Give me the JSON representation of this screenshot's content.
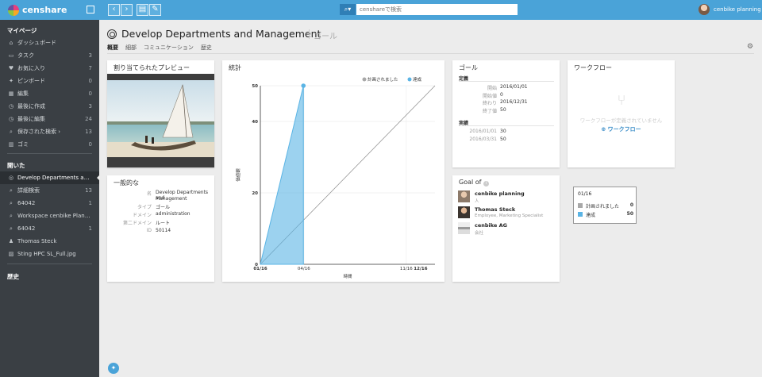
{
  "app": {
    "logo_text": "censhare"
  },
  "header_bar": {
    "search_placeholder": "censhareで検索",
    "user_name": "cenbike planning"
  },
  "sidebar": {
    "mypage_heading": "マイページ",
    "mypage_items": [
      {
        "icon": "home-icon",
        "glyph": "⌂",
        "label": "ダッシュボード",
        "count": ""
      },
      {
        "icon": "inbox-icon",
        "glyph": "▭",
        "label": "タスク",
        "count": "3"
      },
      {
        "icon": "heart-icon",
        "glyph": "♥",
        "label": "お気に入り",
        "count": "7"
      },
      {
        "icon": "pin-icon",
        "glyph": "✦",
        "label": "ピンボード",
        "count": "0"
      },
      {
        "icon": "edit-icon",
        "glyph": "▦",
        "label": "編集",
        "count": "0"
      },
      {
        "icon": "clock-icon",
        "glyph": "◷",
        "label": "最後に作成",
        "count": "3"
      },
      {
        "icon": "clock-icon",
        "glyph": "◷",
        "label": "最後に編集",
        "count": "24"
      },
      {
        "icon": "search-icon",
        "glyph": "⌕",
        "label": "保存された検索  ›",
        "count": "13"
      },
      {
        "icon": "trash-icon",
        "glyph": "▥",
        "label": "ゴミ",
        "count": "0"
      }
    ],
    "opened_heading": "開いた",
    "opened_items": [
      {
        "icon": "target-icon",
        "glyph": "◎",
        "label": "Develop Departments and Ma...",
        "count": ""
      },
      {
        "icon": "search-icon",
        "glyph": "⌕",
        "label": "詳細検索",
        "count": "13"
      },
      {
        "icon": "search-icon",
        "glyph": "⌕",
        "label": "64042",
        "count": "1"
      },
      {
        "icon": "search-icon",
        "glyph": "⌕",
        "label": "Workspace cenbike Planning",
        "count": ""
      },
      {
        "icon": "search-icon",
        "glyph": "⌕",
        "label": "64042",
        "count": "1"
      },
      {
        "icon": "user-icon",
        "glyph": "♟",
        "label": "Thomas Steck",
        "count": ""
      },
      {
        "icon": "image-icon",
        "glyph": "▨",
        "label": "Sting HPC SL_Full.jpg",
        "count": ""
      }
    ],
    "history_heading": "歴史"
  },
  "page": {
    "title": "Develop Departments and Management",
    "type_label": "ゴール",
    "tabs": [
      "概要",
      "細部",
      "コミュニケーション",
      "歴史"
    ]
  },
  "preview_card": {
    "title": "割り当てられたプレビュー"
  },
  "general_card": {
    "title": "一般的な",
    "rows": [
      {
        "key": "名",
        "value": "Develop Departments and"
      },
      {
        "key": "",
        "value": "Management"
      },
      {
        "key": "タイプ",
        "value": "ゴール"
      },
      {
        "key": "ドメイン",
        "value": "administration"
      },
      {
        "key": "第二ドメイン",
        "value": "ルート"
      },
      {
        "key": "ID",
        "value": "50114"
      }
    ]
  },
  "stats_card": {
    "title": "統計"
  },
  "goal_card": {
    "title": "ゴール",
    "definition_heading": "定義",
    "definition_rows": [
      {
        "key": "開始",
        "value": "2016/01/01"
      },
      {
        "key": "開始値",
        "value": "0"
      },
      {
        "key": "終わり",
        "value": "2016/12/31"
      },
      {
        "key": "終了値",
        "value": "50"
      }
    ],
    "actual_heading": "実績",
    "actual_rows": [
      {
        "key": "2016/01/01",
        "value": "30"
      },
      {
        "key": "2016/03/31",
        "value": "50"
      }
    ]
  },
  "workflow_card": {
    "title": "ワークフロー",
    "empty_text": "ワークフローが定義されていません",
    "add_label": "ワークフロー"
  },
  "goal_of_card": {
    "title": "Goal of",
    "people": [
      {
        "name": "cenbike planning",
        "sub": "人"
      },
      {
        "name": "Thomas Steck",
        "sub": "Employee, Marketing Specialist"
      },
      {
        "name": "cenbike AG",
        "sub": "会社"
      }
    ]
  },
  "tooltip": {
    "date": "01/16",
    "rows": [
      {
        "label": "計画されました",
        "value": "0",
        "color": "#a8a8a8"
      },
      {
        "label": "達成",
        "value": "50",
        "color": "#5ab4e5"
      }
    ]
  },
  "chart_data": {
    "type": "area",
    "title": "",
    "xlabel": "時間",
    "ylabel": "価値観",
    "x_ticks": [
      "01/16",
      "04/16",
      "11/16",
      "12/16"
    ],
    "y_ticks": [
      "0",
      "20",
      "40",
      "50"
    ],
    "ylim": [
      0,
      50
    ],
    "xlim": [
      "2016/01/01",
      "2016/12/31"
    ],
    "legend": {
      "placement": "top-right"
    },
    "series": [
      {
        "name": "計画されました",
        "color": "#a8a8a8",
        "kind": "line",
        "x": [
          "2016/01/01",
          "2016/12/31"
        ],
        "y": [
          0,
          50
        ]
      },
      {
        "name": "達成",
        "color": "#5ab4e5",
        "kind": "area",
        "x": [
          "2016/01/01",
          "2016/03/31"
        ],
        "y": [
          0,
          50
        ]
      }
    ],
    "grid": true
  }
}
